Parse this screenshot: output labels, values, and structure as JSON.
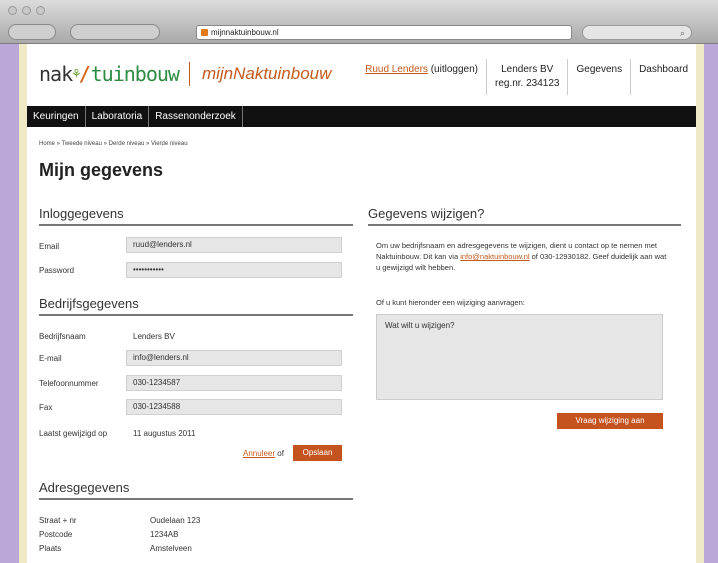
{
  "browser": {
    "url": "mijnnaktuinbouw.nl"
  },
  "header": {
    "logo_prefix": "nak",
    "logo_rest": "tuinbouw",
    "app_name": "mijnNaktuinbouw",
    "user_link": "Ruud Lenders",
    "logout": "(uitloggen)",
    "company": "Lenders BV",
    "reg": "reg.nr. 234123",
    "nav_gegevens": "Gegevens",
    "nav_dashboard": "Dashboard"
  },
  "mainnav": [
    "Keuringen",
    "Laboratoria",
    "Rassenonderzoek"
  ],
  "breadcrumb": "Home » Tweede niveau » Derde niveau » Vierde niveau",
  "title": "Mijn gegevens",
  "login": {
    "heading": "Inloggegevens",
    "email_label": "Email",
    "email_value": "ruud@lenders.nl",
    "password_label": "Password",
    "password_value": "•••••••••••"
  },
  "company": {
    "heading": "Bedrijfsgegevens",
    "name_label": "Bedrijfsnaam",
    "name_value": "Lenders BV",
    "email_label": "E-mail",
    "email_value": "info@lenders.nl",
    "phone_label": "Telefoonnummer",
    "phone_value": "030-1234587",
    "fax_label": "Fax",
    "fax_value": "030-1234588",
    "changed_label": "Laatst gewijzigd op",
    "changed_value": "11 augustus 2011",
    "cancel": "Annuleer",
    "or": "of",
    "save": "Opslaan"
  },
  "address": {
    "heading": "Adresgegevens",
    "street_label": "Straat + nr",
    "street_value": "Oudelaan 123",
    "zip_label": "Postcode",
    "zip_value": "1234AB",
    "city_label": "Plaats",
    "city_value": "Amstelveen"
  },
  "change": {
    "heading": "Gegevens wijzigen?",
    "p1_a": "Om uw bedrijfsnaam en adresgegevens te wijzigen, dient u contact op te nemen met Naktuinbouw. Dit kan via ",
    "p1_link": "info@naktuinbouw.nl",
    "p1_b": " of 030-12930182. Geef duidelijk aan wat u gewijzigd wilt hebben.",
    "p2": "Of u kunt hieronder een wijziging aanvragen:",
    "placeholder": "Wat wilt u wijzigen?",
    "button": "Vraag wijziging aan"
  }
}
